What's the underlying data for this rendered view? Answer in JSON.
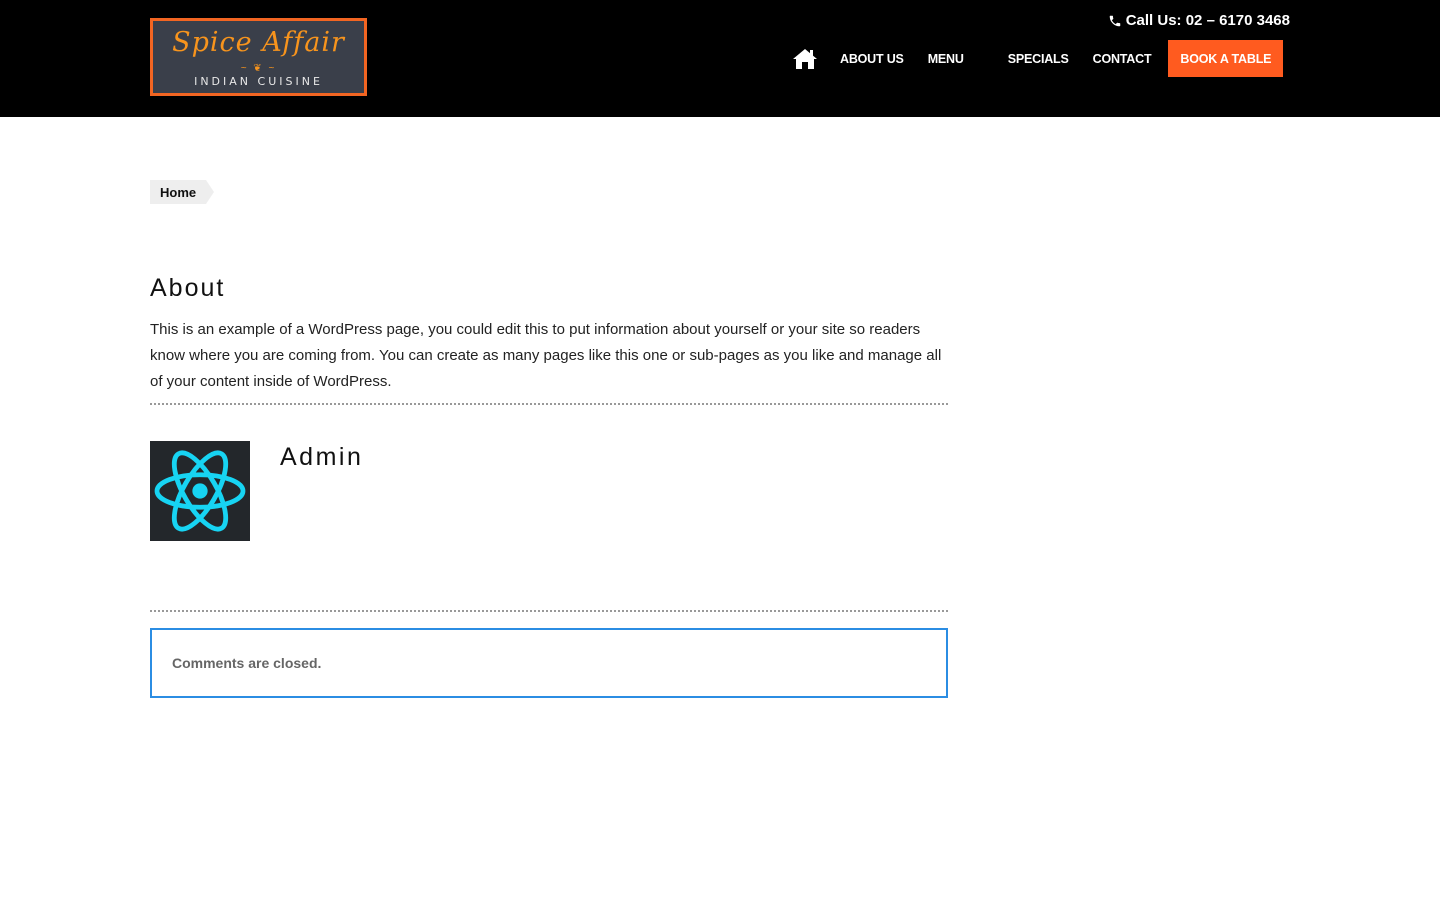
{
  "header": {
    "logo": {
      "script": "Spice Affair",
      "ornament": "~ ❦ ~",
      "subtitle": "INDIAN CUISINE"
    },
    "phone": {
      "icon": "phone-icon",
      "text": "Call Us: 02 – 6170 3468"
    },
    "nav": {
      "home_icon": "home-icon",
      "items": [
        {
          "label": "ABOUT US"
        },
        {
          "label": "MENU"
        },
        {
          "label": "SPECIALS"
        },
        {
          "label": "CONTACT"
        }
      ],
      "cta": "BOOK A TABLE"
    },
    "colors": {
      "header_bg": "#000000",
      "accent": "#ff5b1f",
      "comment_border": "#2b8de3"
    }
  },
  "breadcrumb": {
    "items": [
      {
        "label": "Home"
      }
    ]
  },
  "page": {
    "title": "About",
    "body": "This is an example of a WordPress page, you could edit this to put information about yourself or your site so readers know where you are coming from. You can create as many pages like this one or sub-pages as you like and manage all of your content inside of WordPress."
  },
  "author": {
    "avatar_icon": "react-atom-icon",
    "name": "Admin"
  },
  "comments": {
    "status": "Comments are closed."
  }
}
